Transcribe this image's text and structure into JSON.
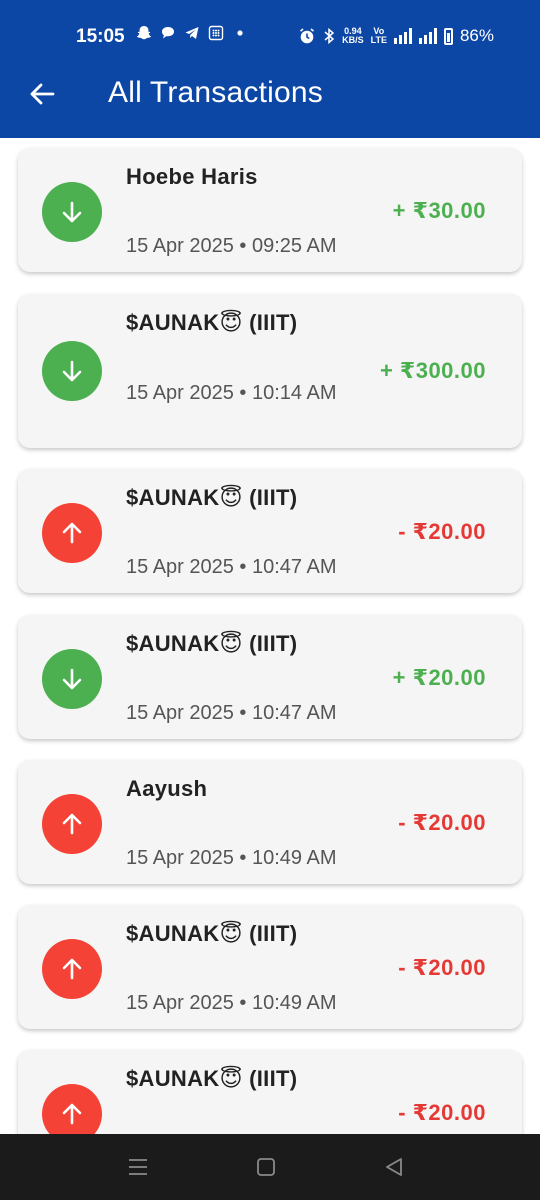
{
  "status_bar": {
    "time": "15:05",
    "net_speed_value": "0.94",
    "net_speed_unit": "KB/S",
    "battery": "86%"
  },
  "app_bar": {
    "title": "All Transactions"
  },
  "transactions": [
    {
      "name": "Hoebe Haris",
      "date": "15 Apr 2025 • 09:25 AM",
      "amount": "+ ₹30.00",
      "type": "credit"
    },
    {
      "name": "$AUNAK😇 (IIIT)",
      "date": "15 Apr 2025 • 10:14 AM",
      "amount": "+ ₹300.00",
      "type": "credit"
    },
    {
      "name": "$AUNAK😇 (IIIT)",
      "date": "15 Apr 2025 • 10:47 AM",
      "amount": "- ₹20.00",
      "type": "debit"
    },
    {
      "name": "$AUNAK😇 (IIIT)",
      "date": "15 Apr 2025 • 10:47 AM",
      "amount": "+ ₹20.00",
      "type": "credit"
    },
    {
      "name": "Aayush",
      "date": "15 Apr 2025 • 10:49 AM",
      "amount": "- ₹20.00",
      "type": "debit"
    },
    {
      "name": "$AUNAK😇 (IIIT)",
      "date": "15 Apr 2025 • 10:49 AM",
      "amount": "- ₹20.00",
      "type": "debit"
    },
    {
      "name": "$AUNAK😇 (IIIT)",
      "date": "",
      "amount": "- ₹20.00",
      "type": "debit"
    }
  ],
  "colors": {
    "primary": "#0c47a6",
    "credit": "#4caf50",
    "debit": "#f44336"
  },
  "icons": {
    "credit": "arrow-down-icon",
    "debit": "arrow-up-icon"
  }
}
